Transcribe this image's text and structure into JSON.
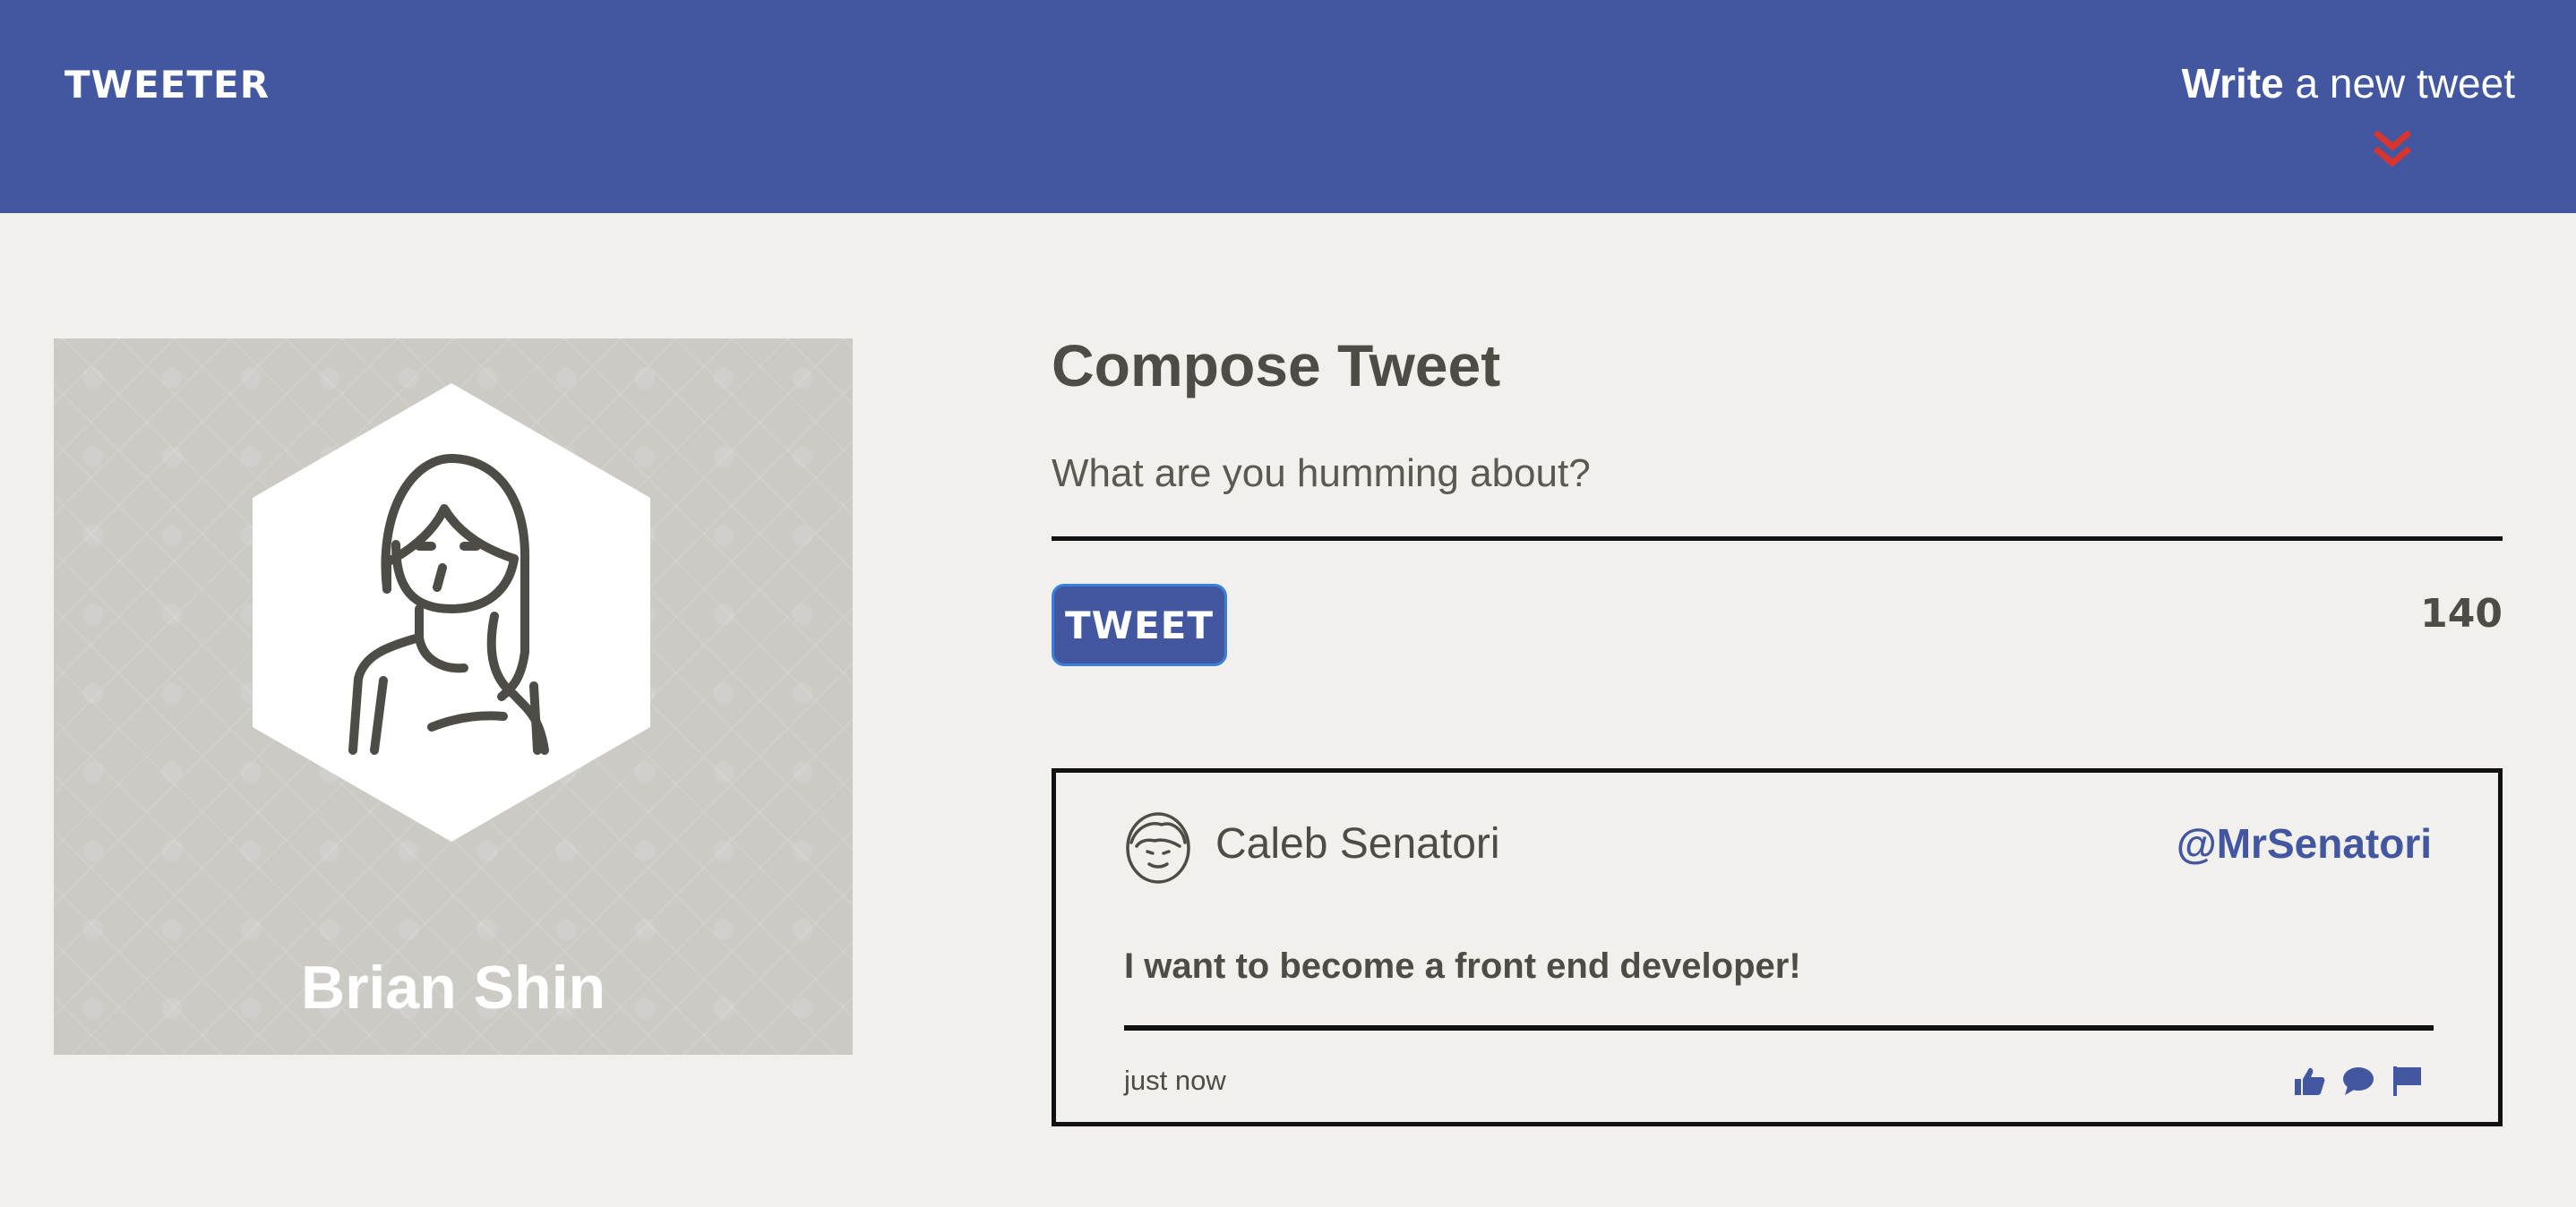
{
  "header": {
    "logo": "TWEETER",
    "compose_bold": "Write",
    "compose_rest": " a new tweet"
  },
  "profile": {
    "name": "Brian Shin"
  },
  "composer": {
    "title": "Compose Tweet",
    "placeholder": "What are you humming about?",
    "button_label": "TWEET",
    "char_count": "140"
  },
  "tweets": [
    {
      "author": "Caleb Senatori",
      "handle": "@MrSenatori",
      "body": "I want to become a front end developer!",
      "time": "just now"
    }
  ],
  "icons": {
    "chevron": "double-chevron-down",
    "like": "thumbs-up",
    "reply": "speech-bubble",
    "report": "flag"
  },
  "colors": {
    "nav": "#4257a0",
    "background": "#f1f0ec",
    "accent_red": "#d9352f",
    "text": "#4d4c46"
  }
}
